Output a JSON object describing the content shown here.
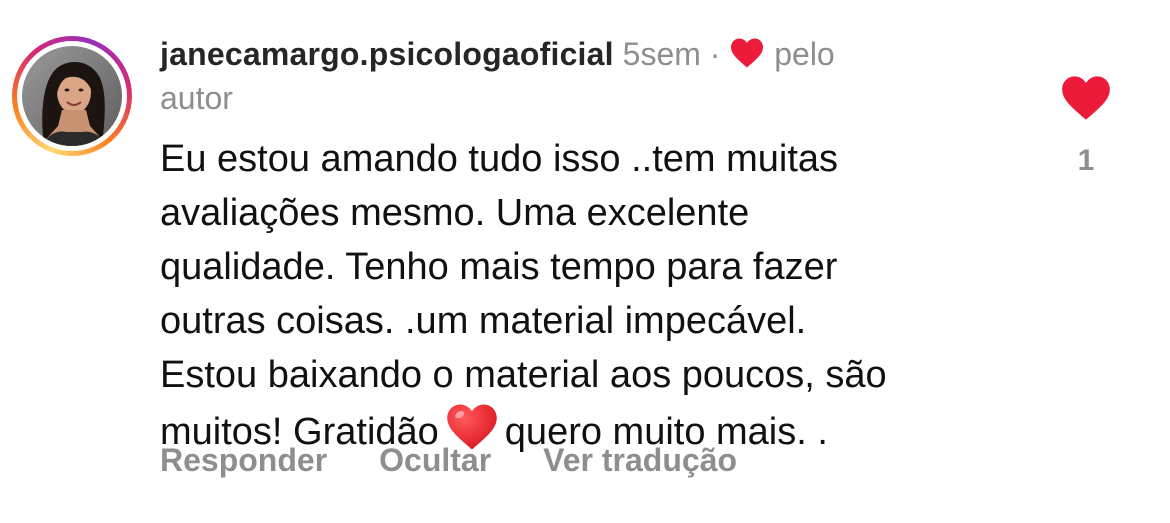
{
  "comment": {
    "username": "janecamargo.psicologaoficial",
    "time": "5sem",
    "separator": "·",
    "liked_by_author_line1": "pelo",
    "liked_by_author_line2": "autor",
    "text_before_emoji": "Eu estou amando tudo isso ..tem muitas\navaliações mesmo. Uma excelente\nqualidade. Tenho mais tempo para fazer\noutras coisas. .um material impecável.\nEstou baixando o material aos poucos, são\nmuitos! Gratidão",
    "text_after_emoji": "quero muito mais. .",
    "emoji": "red-heart",
    "like_count": "1"
  },
  "actions": {
    "reply": "Responder",
    "hide": "Ocultar",
    "see_translation": "Ver tradução"
  },
  "colors": {
    "heart_red": "#ed1b3a",
    "meta_gray": "#8e8e8e",
    "username": "#262626",
    "text": "#111111"
  },
  "icons": {
    "author_liked": "heart-icon",
    "like_button": "heart-filled-icon",
    "emoji": "red-heart-emoji-icon"
  }
}
